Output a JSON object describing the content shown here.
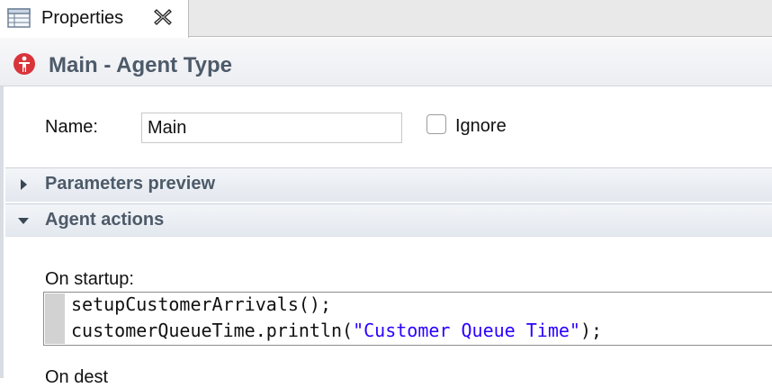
{
  "tab": {
    "label": "Properties",
    "icon": "table-icon",
    "close_icon": "close-icon"
  },
  "header": {
    "title": "Main - Agent Type",
    "icon": "agent-type-icon",
    "icon_color": "#d9343a"
  },
  "form": {
    "name_label": "Name:",
    "name_value": "Main",
    "ignore_label": "Ignore",
    "ignore_checked": false
  },
  "sections": {
    "parameters_preview": {
      "title": "Parameters preview",
      "expanded": false
    },
    "agent_actions": {
      "title": "Agent actions",
      "expanded": true
    }
  },
  "agent_actions": {
    "startup_label": "On startup:",
    "startup_code": {
      "line1": "setupCustomerArrivals();",
      "line2_prefix": "customerQueueTime.println(",
      "line2_string": "\"Customer Queue Time\"",
      "line2_suffix": ");"
    },
    "next_label_partial": "On dest"
  },
  "colors": {
    "accent_text": "#4d5a69",
    "string_literal": "#2a00ff"
  }
}
